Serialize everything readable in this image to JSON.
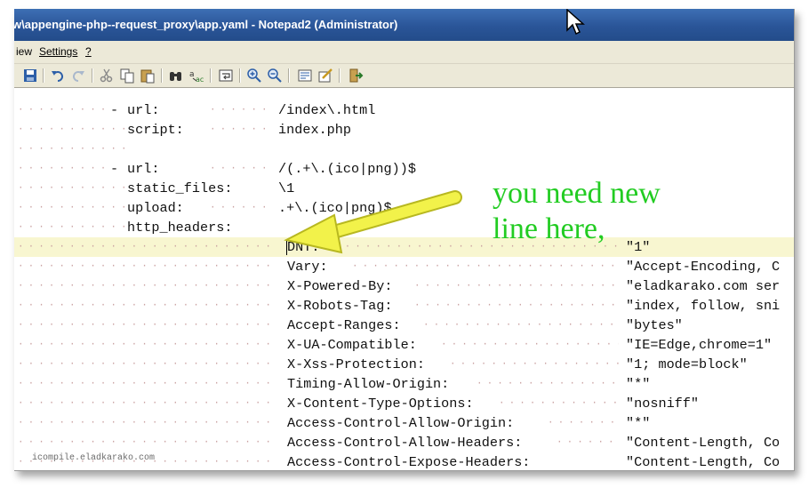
{
  "window": {
    "title": "w\\appengine-php--request_proxy\\app.yaml - Notepad2 (Administrator)"
  },
  "menubar": {
    "items": [
      "iew",
      "Settings",
      "?"
    ]
  },
  "toolbar": {
    "buttons": [
      "save-icon",
      "undo-icon",
      "redo-icon",
      "cut-icon",
      "copy-icon",
      "paste-icon",
      "find-icon",
      "replace-icon",
      "word-wrap-icon",
      "zoom-in-icon",
      "zoom-out-icon",
      "select-scheme-icon",
      "customize-schemes-icon",
      "exit-icon"
    ]
  },
  "editor": {
    "lines": [
      {
        "dash": "-",
        "key": "url:",
        "value": "/index\\.html",
        "extra": ""
      },
      {
        "dash": "",
        "key": "script:",
        "value": "index.php",
        "extra": ""
      },
      {
        "dash": "",
        "key": "",
        "value": "",
        "extra": ""
      },
      {
        "dash": "-",
        "key": "url:",
        "value": "/(.+\\.(ico|png))$",
        "extra": ""
      },
      {
        "dash": "",
        "key": "static_files:",
        "value": "\\1",
        "extra": ""
      },
      {
        "dash": "",
        "key": "upload:",
        "value": ".+\\.(ico|png)$",
        "extra": ""
      },
      {
        "dash": "",
        "key": "http_headers:",
        "value": "",
        "extra": ""
      },
      {
        "dash": "",
        "key": "",
        "value": "DNT:",
        "extra": "\"1\""
      },
      {
        "dash": "",
        "key": "",
        "value": "Vary:",
        "extra": "\"Accept-Encoding, C"
      },
      {
        "dash": "",
        "key": "",
        "value": "X-Powered-By:",
        "extra": "\"eladkarako.com ser"
      },
      {
        "dash": "",
        "key": "",
        "value": "X-Robots-Tag:",
        "extra": "\"index, follow, sni"
      },
      {
        "dash": "",
        "key": "",
        "value": "Accept-Ranges:",
        "extra": "\"bytes\""
      },
      {
        "dash": "",
        "key": "",
        "value": "X-UA-Compatible:",
        "extra": "\"IE=Edge,chrome=1\""
      },
      {
        "dash": "",
        "key": "",
        "value": "X-Xss-Protection:",
        "extra": "\"1; mode=block\""
      },
      {
        "dash": "",
        "key": "",
        "value": "Timing-Allow-Origin:",
        "extra": "\"*\""
      },
      {
        "dash": "",
        "key": "",
        "value": "X-Content-Type-Options:",
        "extra": "\"nosniff\""
      },
      {
        "dash": "",
        "key": "",
        "value": "Access-Control-Allow-Origin:",
        "extra": "\"*\""
      },
      {
        "dash": "",
        "key": "",
        "value": "Access-Control-Allow-Headers:",
        "extra": "\"Content-Length, Co"
      },
      {
        "dash": "",
        "key": "",
        "value": "Access-Control-Expose-Headers:",
        "extra": "\"Content-Length, Co"
      }
    ]
  },
  "annotation": {
    "line1": "you need new",
    "line2": "line here,",
    "color": "#22cc22",
    "arrow_color": "#f2f24a"
  },
  "watermark": "icompile.eladkarako.com"
}
